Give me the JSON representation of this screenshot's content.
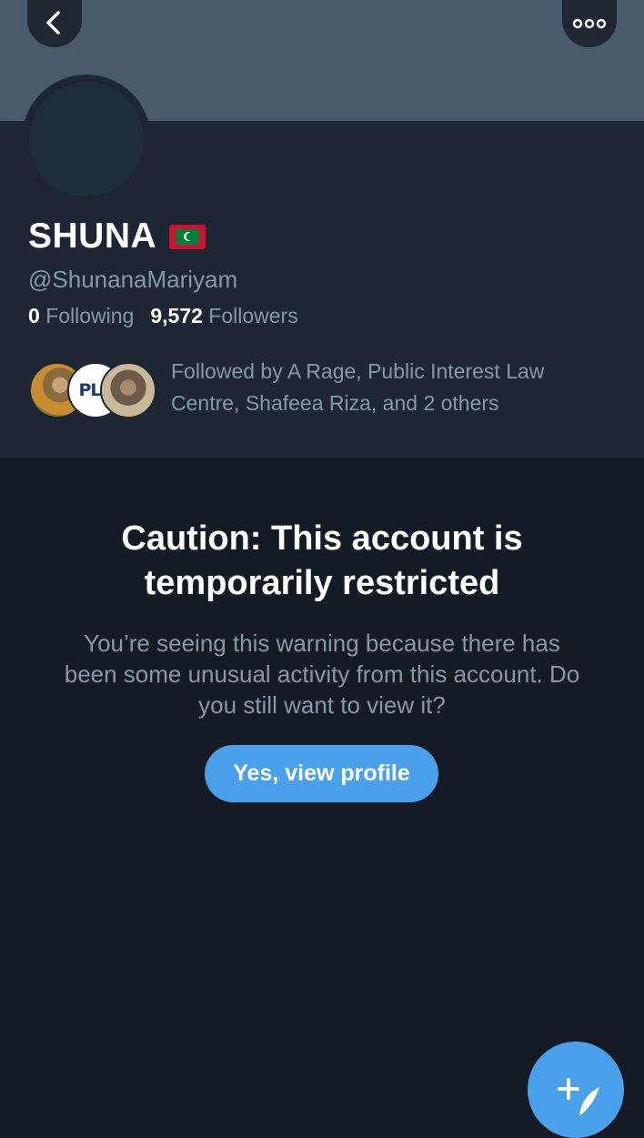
{
  "header": {
    "back_icon": "chevron-left-icon",
    "more_icon": "more-dots-icon"
  },
  "profile": {
    "name": "SHUNA",
    "flag": "maldives-flag",
    "handle": "@ShunanaMariyam",
    "following_count": "0",
    "following_label": "Following",
    "followers_count": "9,572",
    "followers_label": "Followers",
    "followed_by_text": "Followed by A Rage, Public Interest Law Centre, Shafeea Riza, and 2 others",
    "followed_avatar_2_text": "PLC"
  },
  "warning": {
    "title": "Caution: This account is temporarily restricted",
    "description": "You’re seeing this warning because there has been some unusual activity from this account. Do you still want to view it?",
    "button_label": "Yes, view profile"
  },
  "fab": {
    "icon": "compose-tweet-icon"
  },
  "colors": {
    "background": "#141b24",
    "profile_background": "#1c2733",
    "banner": "#4a5b6c",
    "accent": "#4aa1eb",
    "secondary_text": "#8899a6"
  }
}
